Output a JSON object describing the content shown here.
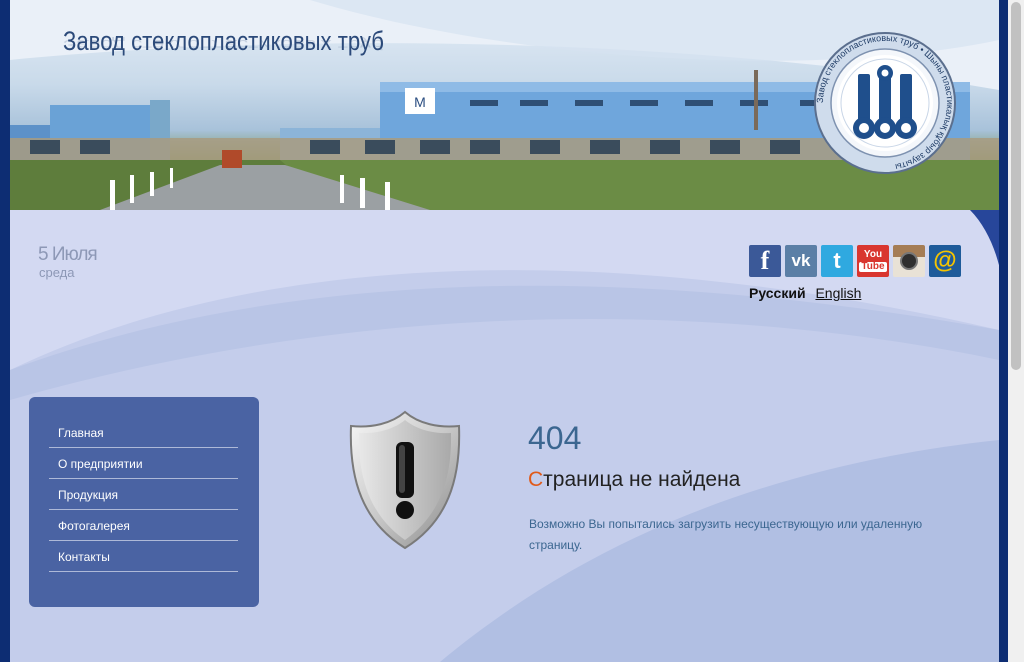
{
  "header": {
    "site_title": "Завод стеклопластиковых труб",
    "logo_ring_text": "Завод стеклопластиковых труб • Шыны пластикалық құбыр зауыты"
  },
  "date": {
    "day": "5 Июля",
    "weekday": "среда"
  },
  "social": [
    {
      "name": "facebook",
      "glyph": "f",
      "color": "#3b5998"
    },
    {
      "name": "vk",
      "glyph": "vk",
      "color": "#5b7fa6"
    },
    {
      "name": "twitter",
      "glyph": "t",
      "color": "#2fa9e0"
    },
    {
      "name": "youtube",
      "glyph": "You Tube",
      "color": "#d9362f"
    },
    {
      "name": "instagram",
      "glyph": "◉",
      "color": "#8a6a4a"
    },
    {
      "name": "mail",
      "glyph": "@",
      "color": "#1e5b9a"
    }
  ],
  "language": {
    "current": "Русский",
    "other": "English"
  },
  "menu": {
    "items": [
      {
        "label": "Главная"
      },
      {
        "label": "О предприятии"
      },
      {
        "label": "Продукция"
      },
      {
        "label": "Фотогалерея"
      },
      {
        "label": "Контакты"
      }
    ]
  },
  "error": {
    "code": "404",
    "title_first_letter": "С",
    "title_rest": "траница не найдена",
    "message": "Возможно Вы попытались загрузить несуществующую или удаленную страницу."
  }
}
